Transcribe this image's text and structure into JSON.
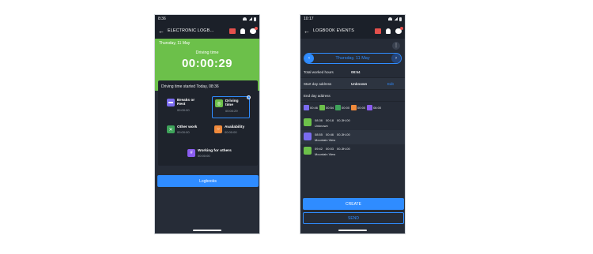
{
  "colors": {
    "accent": "#2f8cff",
    "green": "#6cc04a",
    "rest": "#7b6cf0",
    "work": "#3ea35a",
    "availability": "#f08a3c",
    "others": "#8a5cf0",
    "dark": "#262c37"
  },
  "phone1": {
    "status_time": "8:36",
    "title": "ELECTRONIC LOGB…",
    "date": "Thursday, 11 May",
    "mode_label": "Driving time",
    "timer": "00:00:29",
    "started_text": "Driving time started Today, 08:36",
    "activities": [
      {
        "name": "Breaks or Rest",
        "time": "00:00:00",
        "icon": "bed-icon"
      },
      {
        "name": "Driving time",
        "time": "00:00:29",
        "icon": "steering-wheel-icon"
      },
      {
        "name": "Other work",
        "time": "00:00:00",
        "icon": "tools-icon"
      },
      {
        "name": "Availability",
        "time": "00:00:00",
        "icon": "clock-icon"
      },
      {
        "name": "Working for others",
        "time": "00:00:00",
        "icon": "hash-icon"
      }
    ],
    "logbooks_label": "Logbooks"
  },
  "phone2": {
    "status_time": "10:17",
    "title": "LOGBOOK EVENTS",
    "date": "Thursday, 11 May",
    "rows": {
      "worked_key": "Total worked hours",
      "worked_val": "08:54",
      "start_key": "Start day address",
      "start_val": "Unknown",
      "edit_label": "Edit",
      "end_key": "End day address"
    },
    "chips": [
      "00:46",
      "00:54",
      "00:00",
      "00:00",
      "06:00"
    ],
    "events": [
      {
        "start": "08:36",
        "end": "00:18",
        "dur": "00-3H-00",
        "place": "Unknown"
      },
      {
        "start": "08:55",
        "end": "00:46",
        "dur": "00-3H-00",
        "place": "Mountain View"
      },
      {
        "start": "09:42",
        "end": "00:03",
        "dur": "00-3H-00",
        "place": "Mountain View"
      }
    ],
    "create_label": "CREATE",
    "send_label": "SEND"
  }
}
